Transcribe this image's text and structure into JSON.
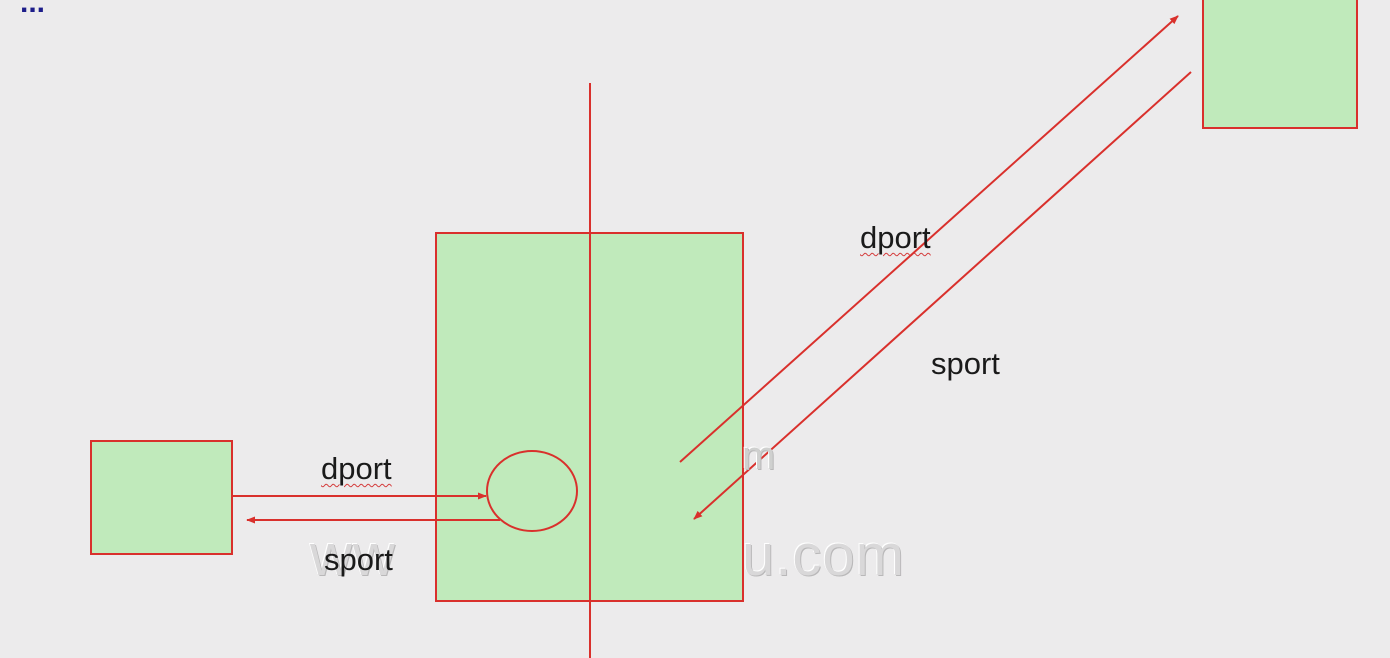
{
  "colors": {
    "background": "#ecebec",
    "box_fill": "#c0eabb",
    "stroke": "#d9302c"
  },
  "labels": {
    "left_dport": "dport",
    "left_sport": "sport",
    "right_dport": "dport",
    "right_sport": "sport"
  },
  "watermark": {
    "left": "ww",
    "right": "u.com",
    "middle": "m"
  }
}
